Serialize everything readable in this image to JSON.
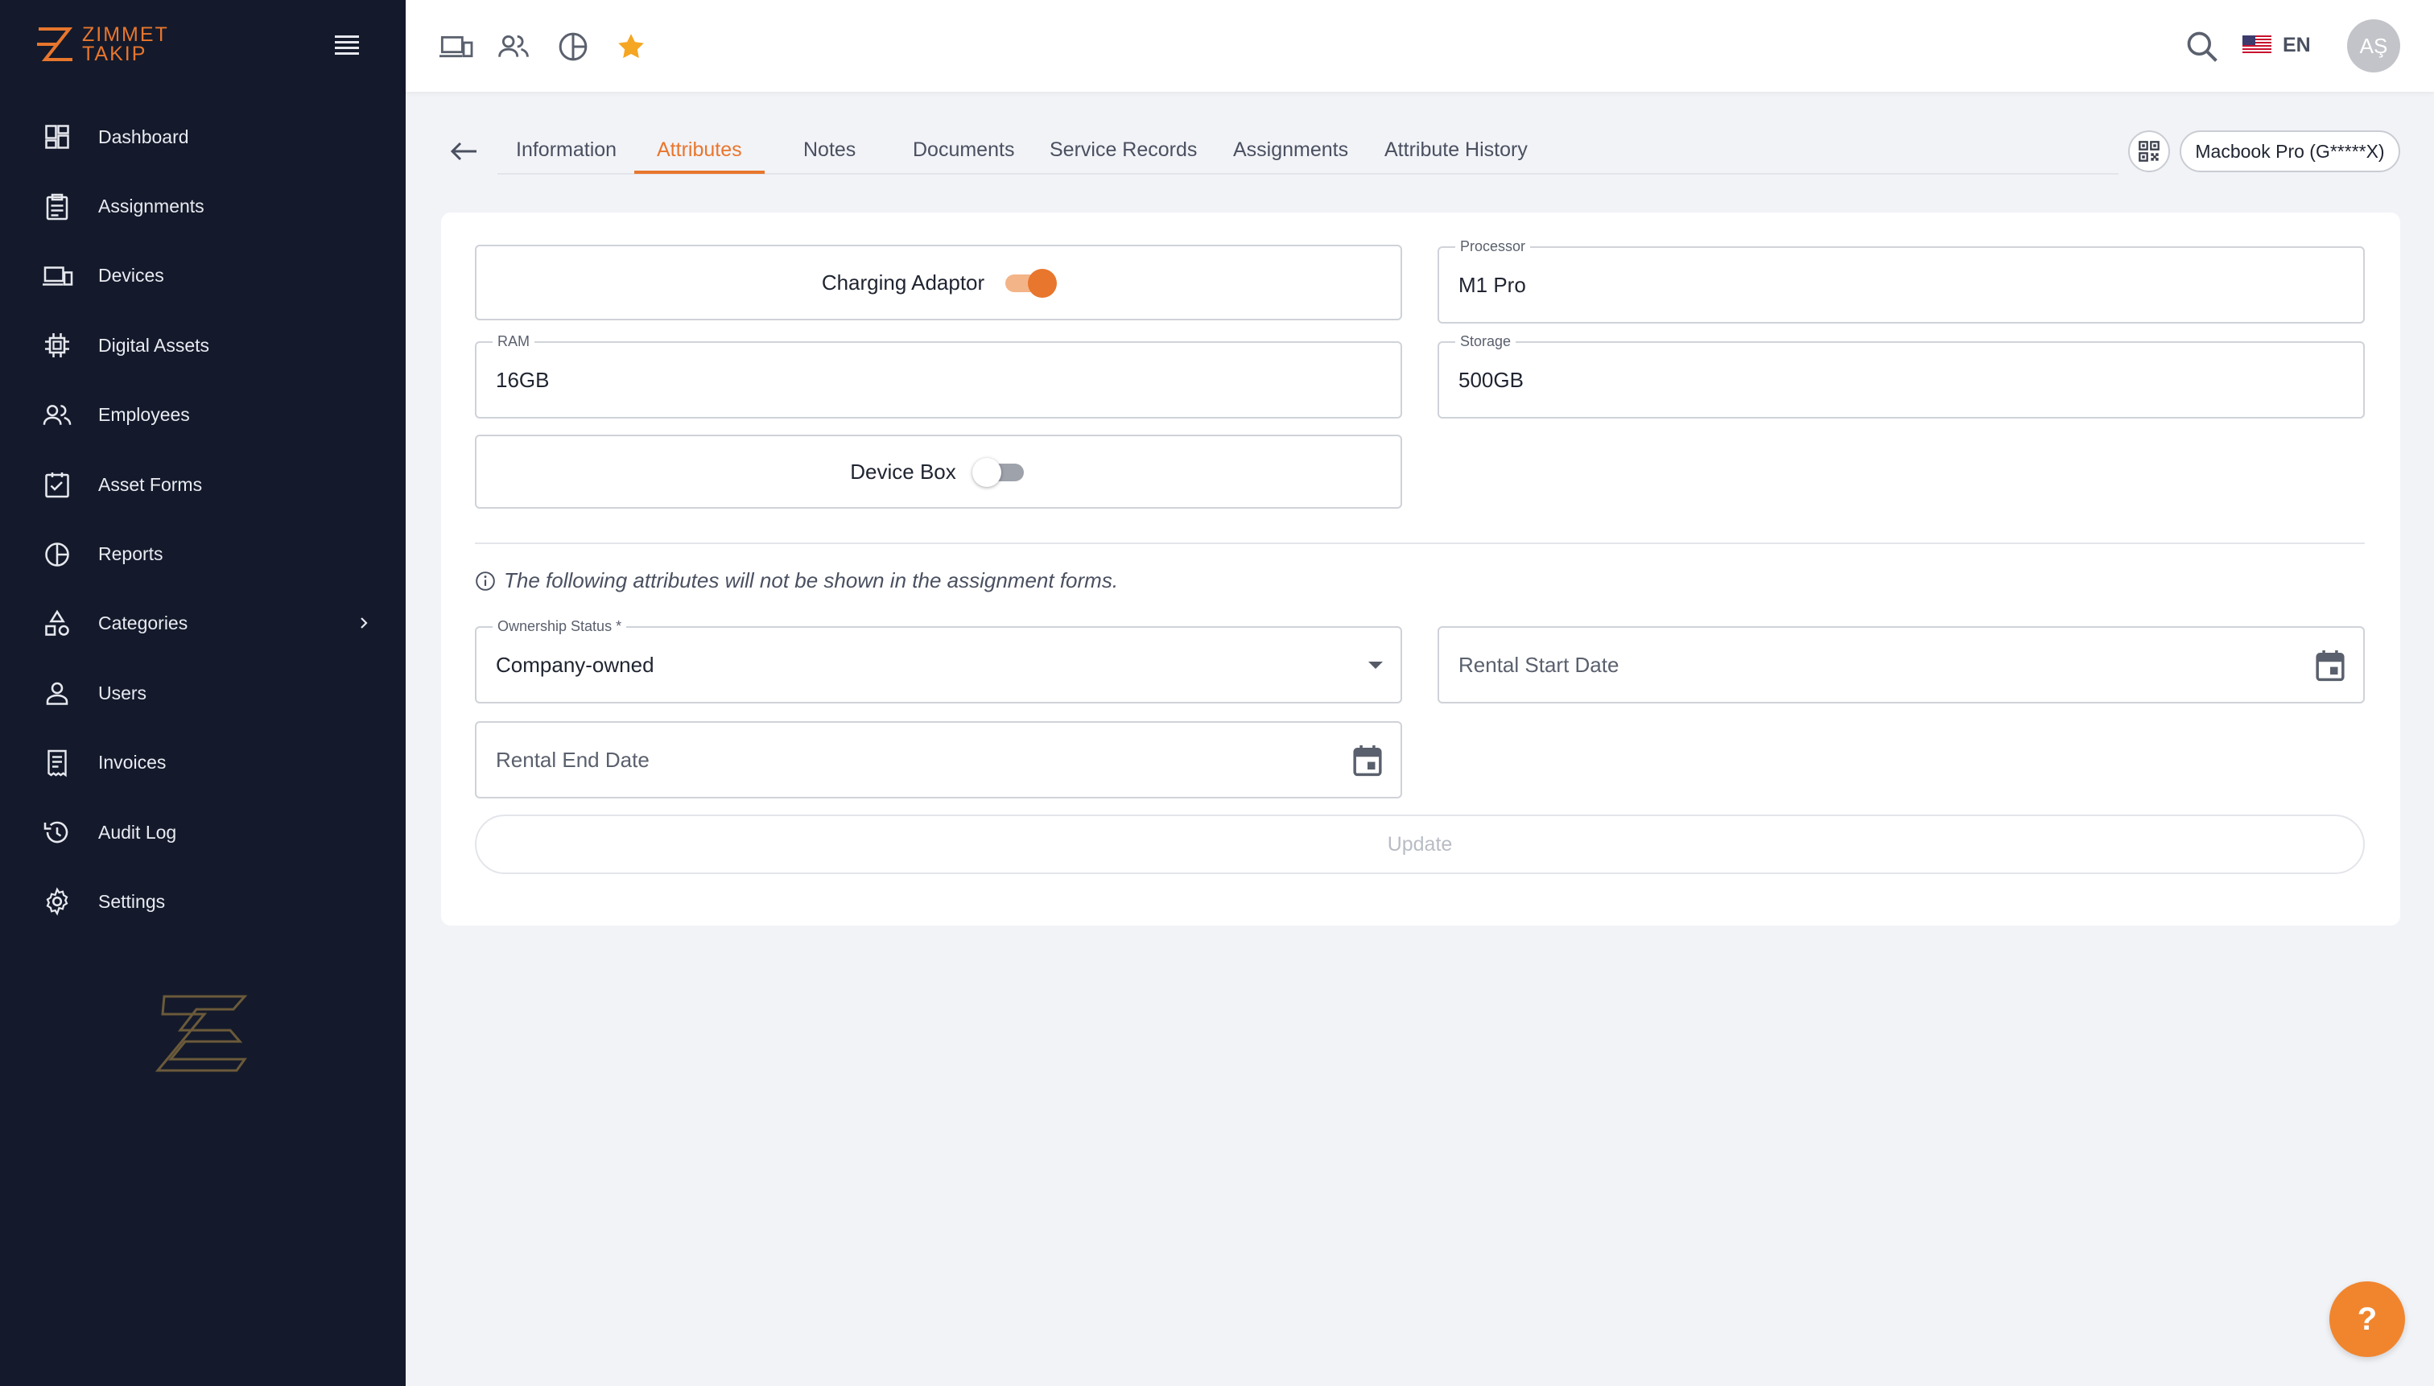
{
  "brand": {
    "line1": "ZIMMET",
    "line2": "TAKIP",
    "accent": "#e8762d"
  },
  "sidebar": {
    "items": [
      {
        "label": "Dashboard",
        "icon": "dashboard-icon"
      },
      {
        "label": "Assignments",
        "icon": "clipboard-icon"
      },
      {
        "label": "Devices",
        "icon": "devices-icon"
      },
      {
        "label": "Digital Assets",
        "icon": "chip-icon"
      },
      {
        "label": "Employees",
        "icon": "people-icon"
      },
      {
        "label": "Asset Forms",
        "icon": "checked-calendar-icon"
      },
      {
        "label": "Reports",
        "icon": "pie-chart-icon"
      },
      {
        "label": "Categories",
        "icon": "categories-icon"
      },
      {
        "label": "Users",
        "icon": "user-icon"
      },
      {
        "label": "Invoices",
        "icon": "receipt-icon"
      },
      {
        "label": "Audit Log",
        "icon": "history-icon"
      },
      {
        "label": "Settings",
        "icon": "gear-icon"
      }
    ]
  },
  "topbar": {
    "language": "EN",
    "avatar_initials": "AŞ",
    "favorite_color": "#f5a623"
  },
  "tabs": [
    "Information",
    "Attributes",
    "Notes",
    "Documents",
    "Service Records",
    "Assignments",
    "Attribute History"
  ],
  "active_tab": "Attributes",
  "device_chip": "Macbook Pro (G*****X)",
  "form": {
    "charging_adaptor": {
      "label": "Charging Adaptor",
      "on": true
    },
    "processor": {
      "label": "Processor",
      "value": "M1 Pro"
    },
    "ram": {
      "label": "RAM",
      "value": "16GB"
    },
    "storage": {
      "label": "Storage",
      "value": "500GB"
    },
    "device_box": {
      "label": "Device Box",
      "on": false
    },
    "note": "The following attributes will not be shown in the assignment forms.",
    "ownership_status": {
      "label": "Ownership Status *",
      "value": "Company-owned"
    },
    "rental_start": {
      "placeholder": "Rental Start Date"
    },
    "rental_end": {
      "placeholder": "Rental End Date"
    },
    "update_label": "Update"
  },
  "help_label": "?"
}
